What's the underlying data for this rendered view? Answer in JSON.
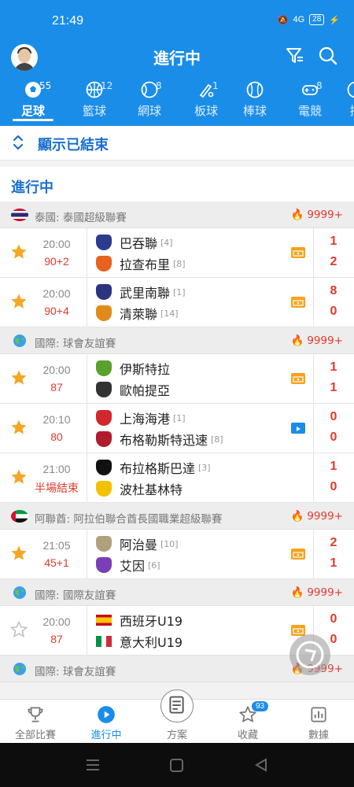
{
  "status_bar": {
    "time": "21:49",
    "signal": "4G",
    "battery": "28"
  },
  "header": {
    "title": "進行中"
  },
  "sport_tabs": [
    {
      "label": "足球",
      "count": "55",
      "icon": "football-icon",
      "active": true
    },
    {
      "label": "籃球",
      "count": "12",
      "icon": "basketball-icon"
    },
    {
      "label": "網球",
      "count": "8",
      "icon": "tennis-icon"
    },
    {
      "label": "板球",
      "count": "1",
      "icon": "cricket-icon"
    },
    {
      "label": "棒球",
      "count": "",
      "icon": "baseball-icon"
    },
    {
      "label": "電競",
      "count": "8",
      "icon": "esports-icon"
    },
    {
      "label": "排",
      "count": "",
      "icon": "volleyball-icon"
    }
  ],
  "show_finished": {
    "label": "顯示已結束"
  },
  "section_title": "進行中",
  "leagues": [
    {
      "name": "泰國: 泰國超級聯賽",
      "hot": "9999+",
      "flag": "thailand-flag",
      "matches": [
        {
          "time": "20:00",
          "status": "90+2",
          "starred": true,
          "home": {
            "name": "巴吞聯",
            "rank": "[4]",
            "crest": "#2b3c8f"
          },
          "away": {
            "name": "拉查布里",
            "rank": "[8]",
            "crest": "#e8621f"
          },
          "home_score": "1",
          "away_score": "2",
          "live": "live-icon"
        },
        {
          "time": "20:00",
          "status": "90+4",
          "starred": true,
          "home": {
            "name": "武里南聯",
            "rank": "[1]",
            "crest": "#2a3580"
          },
          "away": {
            "name": "清萊聯",
            "rank": "[14]",
            "crest": "#e08a1a"
          },
          "home_score": "8",
          "away_score": "0",
          "live": "live-icon"
        }
      ]
    },
    {
      "name": "國際: 球會友誼賽",
      "hot": "9999+",
      "flag": "world-flag",
      "matches": [
        {
          "time": "20:00",
          "status": "87",
          "starred": true,
          "home": {
            "name": "伊斯特拉",
            "rank": "",
            "crest": "#5aa02c"
          },
          "away": {
            "name": "歐帕提亞",
            "rank": "",
            "crest": "#333333"
          },
          "home_score": "1",
          "away_score": "1",
          "live": "live-icon"
        },
        {
          "time": "20:10",
          "status": "80",
          "starred": true,
          "home": {
            "name": "上海海港",
            "rank": "[1]",
            "crest": "#d0282c"
          },
          "away": {
            "name": "布格勒斯特迅速",
            "rank": "[8]",
            "crest": "#b01c2e"
          },
          "home_score": "0",
          "away_score": "0",
          "live": "video-icon"
        },
        {
          "time": "21:00",
          "status": "半場結束",
          "starred": true,
          "home": {
            "name": "布拉格斯巴達",
            "rank": "[3]",
            "crest": "#111111"
          },
          "away": {
            "name": "波杜基林特",
            "rank": "",
            "crest": "#f2c200"
          },
          "home_score": "1",
          "away_score": "0",
          "live": ""
        }
      ]
    },
    {
      "name": "阿聯酋: 阿拉伯聯合酋長國職業超級聯賽",
      "hot": "9999+",
      "flag": "uae-flag",
      "matches": [
        {
          "time": "21:05",
          "status": "45+1",
          "starred": true,
          "home": {
            "name": "阿治曼",
            "rank": "[10]",
            "crest": "#b0a17a"
          },
          "away": {
            "name": "艾因",
            "rank": "[6]",
            "crest": "#7b3fb5"
          },
          "home_score": "2",
          "away_score": "1",
          "live": "live-icon"
        }
      ]
    },
    {
      "name": "國際: 國際友誼賽",
      "hot": "9999+",
      "flag": "world-flag",
      "matches": [
        {
          "time": "20:00",
          "status": "87",
          "starred": false,
          "home": {
            "name": "西班牙U19",
            "rank": "",
            "crest": "spain"
          },
          "away": {
            "name": "意大利U19",
            "rank": "",
            "crest": "italy"
          },
          "home_score": "0",
          "away_score": "0",
          "live": "live-icon"
        }
      ]
    },
    {
      "name": "國際: 球會友誼賽",
      "hot": "9999+",
      "flag": "world-flag",
      "matches": []
    }
  ],
  "bottom_nav": [
    {
      "label": "全部比賽",
      "icon": "trophy-icon"
    },
    {
      "label": "進行中",
      "icon": "play-icon",
      "active": true
    },
    {
      "label": "方案",
      "icon": "document-icon"
    },
    {
      "label": "收藏",
      "icon": "star-icon",
      "badge": "93"
    },
    {
      "label": "數據",
      "icon": "chart-icon"
    }
  ],
  "colors": {
    "primary": "#1a8de8",
    "score_red": "#e23b2e",
    "star": "#f5a623",
    "live_orange": "#f7a21b"
  }
}
